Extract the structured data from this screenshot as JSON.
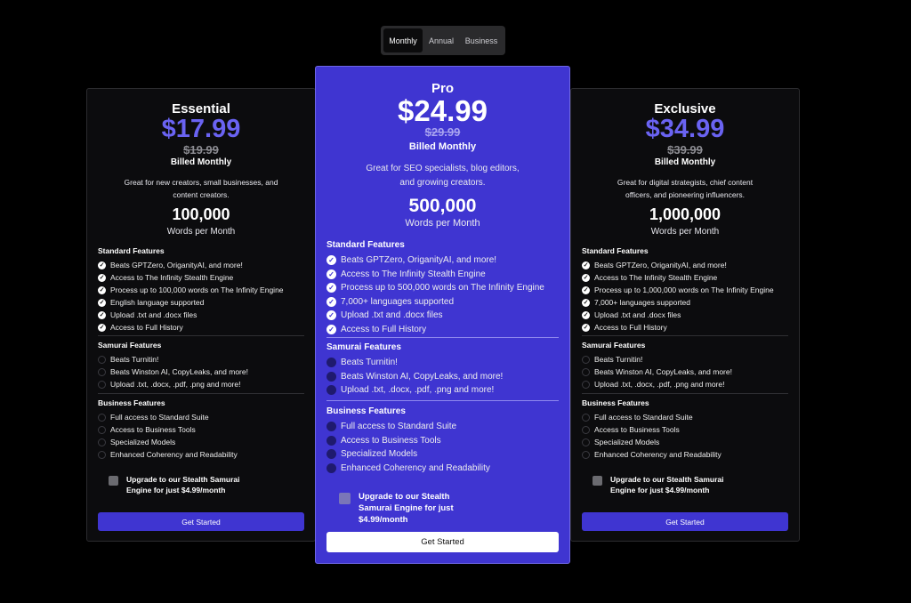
{
  "toggle": {
    "options": [
      "Monthly",
      "Annual",
      "Business"
    ],
    "selected": "Monthly"
  },
  "plans": [
    {
      "name": "Essential",
      "price": "$17.99",
      "old_price": "$19.99",
      "billed": "Billed Monthly",
      "description": "Great for new creators, small businesses, and content creators.",
      "words": "100,000",
      "words_label": "Words per Month",
      "standard_title": "Standard Features",
      "standard": [
        "Beats GPTZero, OriganityAI, and more!",
        "Access to The Infinity Stealth Engine",
        "Process up to 100,000 words on The Infinity Engine",
        "English language supported",
        "Upload .txt and .docx files",
        "Access to Full History"
      ],
      "samurai_title": "Samurai Features",
      "samurai": [
        "Beats Turnitin!",
        "Beats Winston AI, CopyLeaks, and more!",
        "Upload .txt, .docx, .pdf, .png and more!"
      ],
      "business_title": "Business Features",
      "business": [
        "Full access to Standard Suite",
        "Access to Business Tools",
        "Specialized Models",
        "Enhanced Coherency and Readability"
      ],
      "upgrade": "Upgrade to our Stealth Samurai Engine for just $4.99/month",
      "cta": "Get Started"
    },
    {
      "name": "Pro",
      "price": "$24.99",
      "old_price": "$29.99",
      "billed": "Billed Monthly",
      "description": "Great for SEO specialists, blog editors, and growing creators.",
      "words": "500,000",
      "words_label": "Words per Month",
      "standard_title": "Standard Features",
      "standard": [
        "Beats GPTZero, OriganityAI, and more!",
        "Access to The Infinity Stealth Engine",
        "Process up to 500,000 words on The Infinity Engine",
        "7,000+ languages supported",
        "Upload .txt and .docx files",
        "Access to Full History"
      ],
      "samurai_title": "Samurai Features",
      "samurai": [
        "Beats Turnitin!",
        "Beats Winston AI, CopyLeaks, and more!",
        "Upload .txt, .docx, .pdf, .png and more!"
      ],
      "business_title": "Business Features",
      "business": [
        "Full access to Standard Suite",
        "Access to Business Tools",
        "Specialized Models",
        "Enhanced Coherency and Readability"
      ],
      "upgrade": "Upgrade to our Stealth Samurai Engine for just $4.99/month",
      "cta": "Get Started"
    },
    {
      "name": "Exclusive",
      "price": "$34.99",
      "old_price": "$39.99",
      "billed": "Billed Monthly",
      "description": "Great for digital strategists, chief content officers, and pioneering influencers.",
      "words": "1,000,000",
      "words_label": "Words per Month",
      "standard_title": "Standard Features",
      "standard": [
        "Beats GPTZero, OriganityAI, and more!",
        "Access to The Infinity Stealth Engine",
        "Process up to 1,000,000 words on The Infinity Engine",
        "7,000+ languages supported",
        "Upload .txt and .docx files",
        "Access to Full History"
      ],
      "samurai_title": "Samurai Features",
      "samurai": [
        "Beats Turnitin!",
        "Beats Winston AI, CopyLeaks, and more!",
        "Upload .txt, .docx, .pdf, .png and more!"
      ],
      "business_title": "Business Features",
      "business": [
        "Full access to Standard Suite",
        "Access to Business Tools",
        "Specialized Models",
        "Enhanced Coherency and Readability"
      ],
      "upgrade": "Upgrade to our Stealth Samurai Engine for just $4.99/month",
      "cta": "Get Started"
    }
  ],
  "colors": {
    "accent": "#3f35d1",
    "price_accent": "#6a63f2",
    "background": "#000000"
  }
}
